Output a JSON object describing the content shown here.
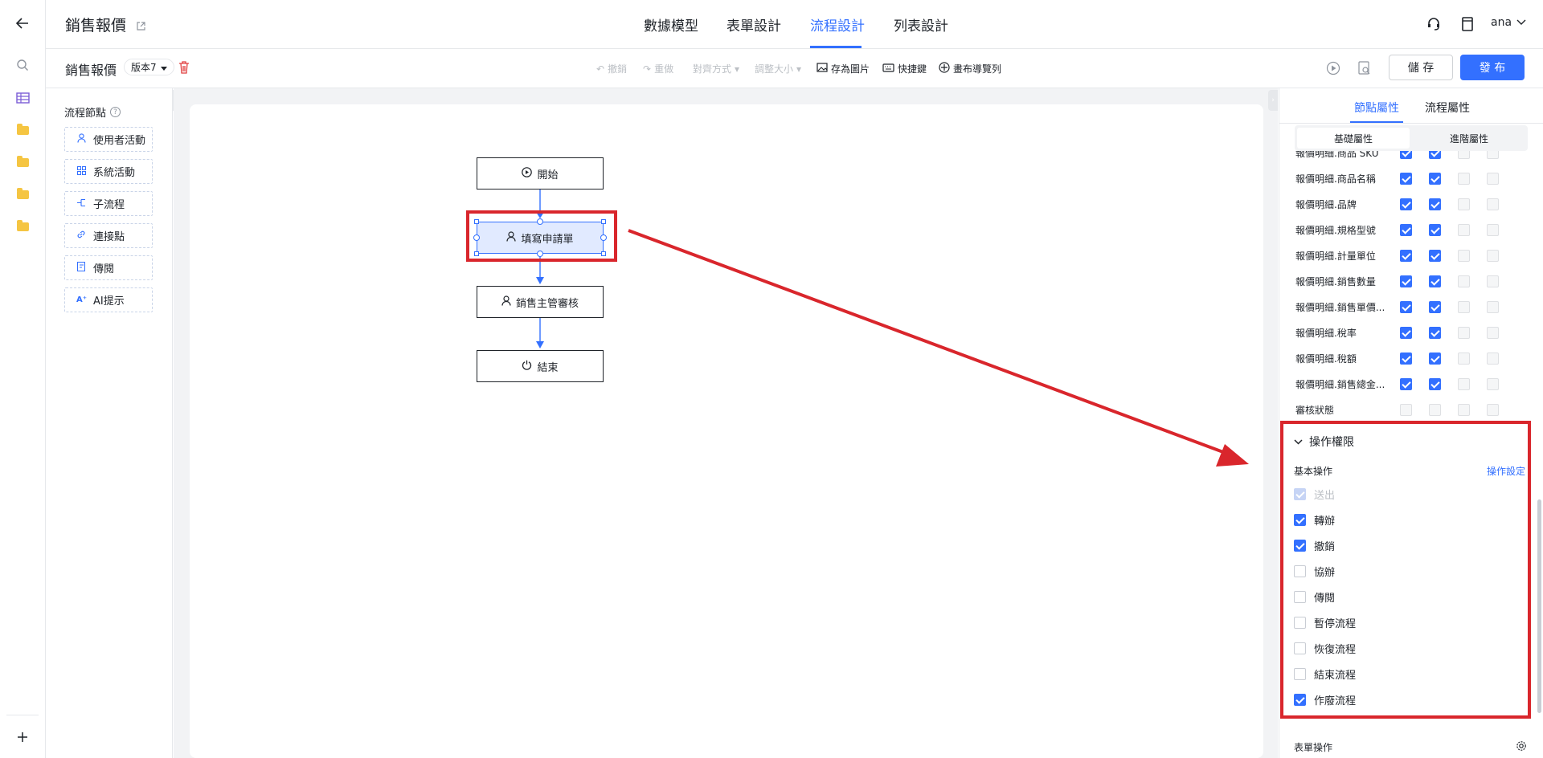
{
  "header": {
    "app_title": "銷售報價",
    "tabs": [
      {
        "label": "數據模型"
      },
      {
        "label": "表單設計"
      },
      {
        "label": "流程設計"
      },
      {
        "label": "列表設計"
      }
    ],
    "user": "ana"
  },
  "toolbar": {
    "form_title": "銷售報價",
    "version": "版本7",
    "undo": "撤銷",
    "redo": "重做",
    "align": "對齊方式",
    "resize": "調整大小",
    "save_image": "存為圖片",
    "shortcuts": "快捷鍵",
    "canvas_nav": "畫布導覽列",
    "save_label": "儲 存",
    "publish_label": "發 布"
  },
  "palette": {
    "title": "流程節點",
    "items": [
      {
        "label": "使用者活動",
        "icon": "user-icon"
      },
      {
        "label": "系統活動",
        "icon": "grid-icon"
      },
      {
        "label": "子流程",
        "icon": "subprocess-icon"
      },
      {
        "label": "連接點",
        "icon": "link-icon"
      },
      {
        "label": "傳閱",
        "icon": "circulate-icon"
      },
      {
        "label": "AI提示",
        "icon": "ai-icon"
      }
    ]
  },
  "flow": {
    "nodes": [
      {
        "label": "開始",
        "icon": "play-icon"
      },
      {
        "label": "填寫申請單",
        "icon": "user-icon"
      },
      {
        "label": "銷售主管審核",
        "icon": "user-icon"
      },
      {
        "label": "結束",
        "icon": "power-icon"
      }
    ]
  },
  "panel": {
    "tabs": [
      {
        "label": "節點屬性"
      },
      {
        "label": "流程屬性"
      }
    ],
    "subtabs": [
      {
        "label": "基礎屬性"
      },
      {
        "label": "進階屬性"
      }
    ],
    "fields": [
      {
        "label": "報價明細.商品 SKU",
        "checks": [
          true,
          true,
          false,
          false
        ]
      },
      {
        "label": "報價明細.商品名稱",
        "checks": [
          true,
          true,
          false,
          false
        ]
      },
      {
        "label": "報價明細.品牌",
        "checks": [
          true,
          true,
          false,
          false
        ]
      },
      {
        "label": "報價明細.規格型號",
        "checks": [
          true,
          true,
          false,
          false
        ]
      },
      {
        "label": "報價明細.計量單位",
        "checks": [
          true,
          true,
          false,
          false
        ]
      },
      {
        "label": "報價明細.銷售數量",
        "checks": [
          true,
          true,
          false,
          false
        ]
      },
      {
        "label": "報價明細.銷售單價...",
        "checks": [
          true,
          true,
          false,
          false
        ]
      },
      {
        "label": "報價明細.稅率",
        "checks": [
          true,
          true,
          false,
          false
        ]
      },
      {
        "label": "報價明細.稅額",
        "checks": [
          true,
          true,
          false,
          false
        ]
      },
      {
        "label": "報價明細.銷售總金...",
        "checks": [
          true,
          true,
          false,
          false
        ]
      },
      {
        "label": "審核狀態",
        "checks": [
          false,
          false,
          false,
          false
        ]
      }
    ],
    "operations": {
      "section_title": "操作權限",
      "basic_label": "基本操作",
      "settings_link": "操作設定",
      "items": [
        {
          "label": "送出",
          "checked": true,
          "disabled": true
        },
        {
          "label": "轉辦",
          "checked": true,
          "disabled": false
        },
        {
          "label": "撤銷",
          "checked": true,
          "disabled": false
        },
        {
          "label": "協辦",
          "checked": false,
          "disabled": false
        },
        {
          "label": "傳閱",
          "checked": false,
          "disabled": false
        },
        {
          "label": "暫停流程",
          "checked": false,
          "disabled": false
        },
        {
          "label": "恢復流程",
          "checked": false,
          "disabled": false
        },
        {
          "label": "結束流程",
          "checked": false,
          "disabled": false
        },
        {
          "label": "作廢流程",
          "checked": true,
          "disabled": false
        }
      ]
    },
    "form_ops_label": "表單操作"
  },
  "colors": {
    "accent": "#3370ff",
    "annotation": "#d9262c"
  }
}
